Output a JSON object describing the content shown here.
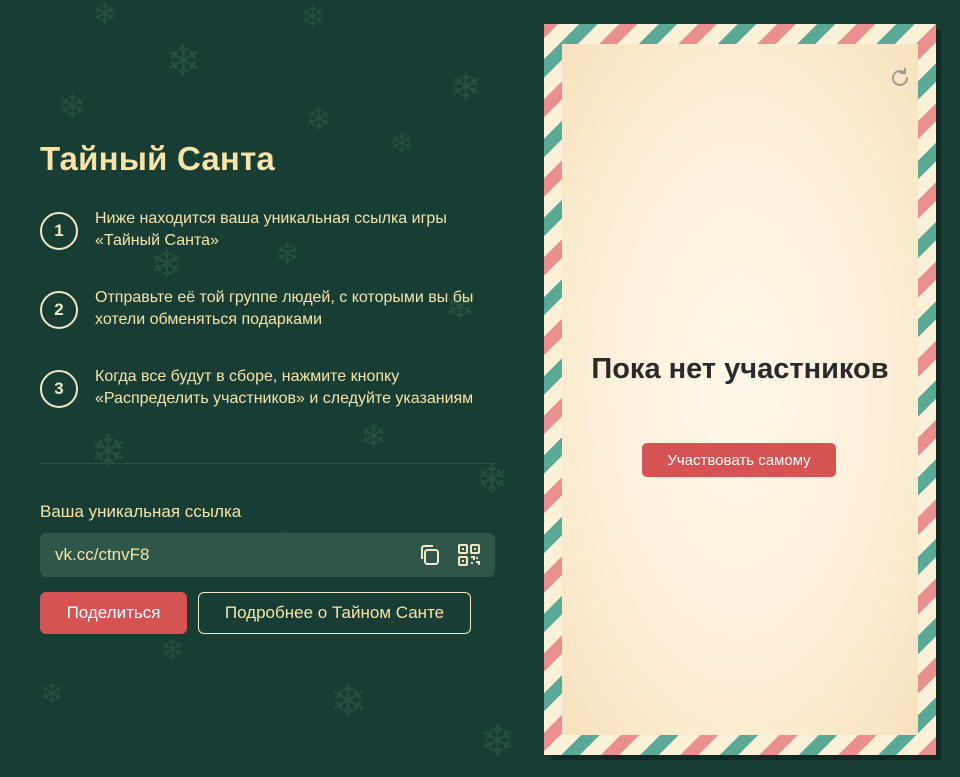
{
  "title": "Тайный Санта",
  "steps": [
    {
      "number": "1",
      "text": "Ниже находится ваша уникальная ссылка игры «Тайный Санта»"
    },
    {
      "number": "2",
      "text": "Отправьте её той группе людей, с которыми вы бы хотели обменяться подарками"
    },
    {
      "number": "3",
      "text": "Когда все будут в сборе, нажмите кнопку «Распределить участников» и следуйте указаниям"
    }
  ],
  "link": {
    "label": "Ваша уникальная ссылка",
    "value": "vk.cc/ctnvF8",
    "copy_icon": "copy-icon",
    "qr_icon": "qr-code-icon"
  },
  "buttons": {
    "share": "Поделиться",
    "more": "Подробнее о Тайном Санте"
  },
  "card": {
    "empty_title": "Пока нет участников",
    "join_button": "Участвовать самому",
    "refresh_icon": "refresh-icon"
  },
  "colors": {
    "background": "#173d34",
    "accent": "#d65353",
    "text": "#f6e4a8",
    "stripe_red": "#e98f8f",
    "stripe_green": "#5aa896"
  }
}
